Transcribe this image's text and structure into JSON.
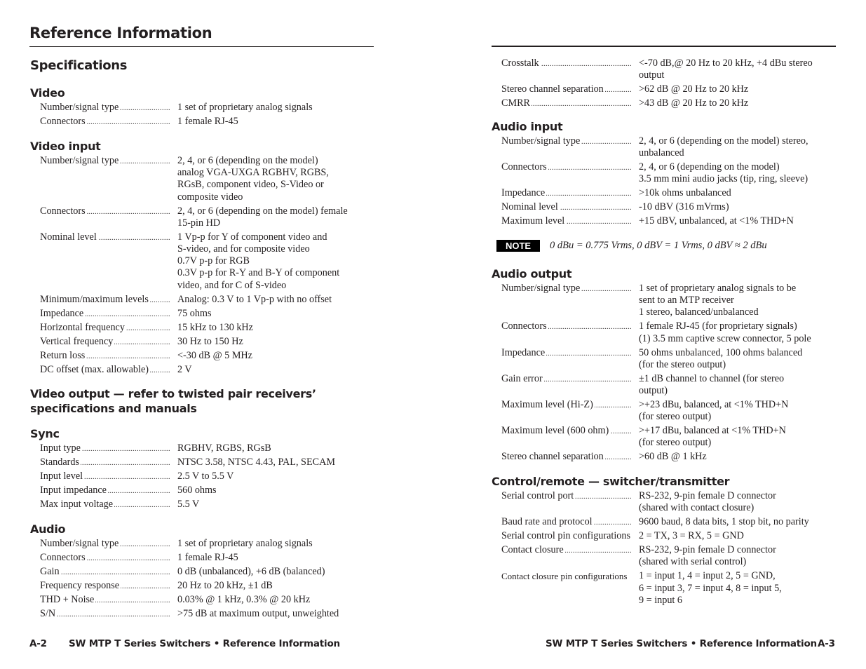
{
  "left_page": {
    "title": "Reference Information",
    "subtitle": "Specifications",
    "sections": {
      "video": {
        "heading": "Video",
        "rows": [
          {
            "label": "Number/signal type",
            "value": [
              "1 set of proprietary analog signals"
            ]
          },
          {
            "label": "Connectors",
            "value": [
              "1 female RJ-45"
            ]
          }
        ]
      },
      "video_input": {
        "heading": "Video input",
        "rows": [
          {
            "label": "Number/signal type",
            "value": [
              "2, 4, or 6 (depending on the model)",
              "analog VGA-UXGA RGBHV, RGBS,",
              "RGsB, component video, S-Video or",
              "composite video"
            ]
          },
          {
            "label": "Connectors",
            "value": [
              "2, 4, or 6 (depending on the model) female",
              "15-pin HD"
            ]
          },
          {
            "label": "Nominal level",
            "value": [
              "1 Vp-p for Y of component video and",
              "S-video, and for composite video",
              "0.7V p-p for RGB",
              "0.3V p-p for R-Y and B-Y of component",
              "video, and for C of S-video"
            ]
          },
          {
            "label": "Minimum/maximum levels",
            "value": [
              "Analog: 0.3 V to 1 Vp-p with no offset"
            ]
          },
          {
            "label": "Impedance",
            "value": [
              "75 ohms"
            ]
          },
          {
            "label": "Horizontal frequency",
            "value": [
              "15 kHz to 130 kHz"
            ]
          },
          {
            "label": "Vertical frequency",
            "value": [
              "30 Hz to 150 Hz"
            ]
          },
          {
            "label": "Return loss",
            "value": [
              "<-30 dB @ 5 MHz"
            ]
          },
          {
            "label": "DC offset (max. allowable)",
            "value": [
              "2 V"
            ]
          }
        ]
      },
      "video_output": {
        "heading_line1": "Video output — refer to twisted pair receivers’",
        "heading_line2": "specifications and manuals"
      },
      "sync": {
        "heading": "Sync",
        "rows": [
          {
            "label": "Input type",
            "value": [
              "RGBHV, RGBS, RGsB"
            ]
          },
          {
            "label": "Standards",
            "value": [
              "NTSC 3.58, NTSC 4.43, PAL, SECAM"
            ]
          },
          {
            "label": "Input level",
            "value": [
              "2.5 V to 5.5 V"
            ]
          },
          {
            "label": "Input impedance",
            "value": [
              "560 ohms"
            ]
          },
          {
            "label": "Max input voltage",
            "value": [
              "5.5 V"
            ]
          }
        ]
      },
      "audio": {
        "heading": "Audio",
        "rows": [
          {
            "label": "Number/signal type",
            "value": [
              "1 set of proprietary analog signals"
            ]
          },
          {
            "label": "Connectors",
            "value": [
              "1 female RJ-45"
            ]
          },
          {
            "label": "Gain",
            "value": [
              "0 dB (unbalanced), +6 dB (balanced)"
            ]
          },
          {
            "label": "Frequency response",
            "value": [
              "20 Hz to 20 kHz, ±1 dB"
            ]
          },
          {
            "label": "THD + Noise",
            "value": [
              "0.03% @ 1 kHz, 0.3% @ 20 kHz"
            ]
          },
          {
            "label": "S/N",
            "value": [
              ">75 dB at maximum output, unweighted"
            ]
          }
        ]
      }
    },
    "footer": {
      "page_number": "A-2",
      "text": "SW MTP T Series Switchers • Reference Information"
    }
  },
  "right_page": {
    "continued_audio": {
      "rows": [
        {
          "label": "Crosstalk",
          "value": [
            "<-70 dB,@ 20 Hz to 20 kHz, +4 dBu stereo",
            "output"
          ]
        },
        {
          "label": "Stereo channel separation",
          "value": [
            ">62 dB @ 20 Hz to 20 kHz"
          ]
        },
        {
          "label": "CMRR",
          "value": [
            ">43 dB @ 20 Hz to 20 kHz"
          ]
        }
      ]
    },
    "audio_input": {
      "heading": "Audio input",
      "rows": [
        {
          "label": "Number/signal type",
          "value": [
            "2, 4, or 6 (depending on the model) stereo,",
            "unbalanced"
          ]
        },
        {
          "label": "Connectors",
          "value": [
            "2, 4, or 6 (depending on the model)",
            "3.5 mm mini audio jacks (tip, ring, sleeve)"
          ]
        },
        {
          "label": "Impedance",
          "value": [
            ">10k ohms unbalanced"
          ]
        },
        {
          "label": "Nominal level",
          "value": [
            "-10 dBV (316 mVrms)"
          ]
        },
        {
          "label": "Maximum level",
          "value": [
            "+15 dBV, unbalanced, at <1% THD+N"
          ]
        }
      ]
    },
    "note": {
      "badge": "NOTE",
      "text": "0 dBu = 0.775 Vrms, 0 dBV = 1 Vrms, 0 dBV ≈ 2 dBu"
    },
    "audio_output": {
      "heading": "Audio output",
      "rows": [
        {
          "label": "Number/signal type",
          "value": [
            "1 set of proprietary analog signals to be",
            "sent to an MTP receiver",
            "1 stereo, balanced/unbalanced"
          ]
        },
        {
          "label": "Connectors",
          "value": [
            "1 female RJ-45 (for proprietary signals)",
            "(1) 3.5 mm captive screw connector, 5 pole"
          ]
        },
        {
          "label": "Impedance",
          "value": [
            "50 ohms unbalanced, 100 ohms balanced",
            "(for the stereo output)"
          ]
        },
        {
          "label": "Gain error",
          "value": [
            "±1 dB channel to channel (for stereo",
            "output)"
          ]
        },
        {
          "label": "Maximum level (Hi-Z)",
          "value": [
            ">+23 dBu, balanced, at <1% THD+N",
            "(for stereo output)"
          ]
        },
        {
          "label": "Maximum level (600 ohm)",
          "value": [
            ">+17 dBu, balanced at <1% THD+N",
            "(for stereo output)"
          ]
        },
        {
          "label": "Stereo channel separation",
          "value": [
            ">60 dB @ 1 kHz"
          ]
        }
      ]
    },
    "control": {
      "heading": "Control/remote — switcher/transmitter",
      "rows": [
        {
          "label": "Serial control port",
          "value": [
            "RS-232, 9-pin female D connector",
            "(shared with contact closure)"
          ]
        },
        {
          "label": "Baud rate and protocol",
          "value": [
            "9600 baud, 8 data bits, 1 stop bit, no parity"
          ]
        },
        {
          "label": "Serial control pin configurations",
          "value": [
            "2 = TX, 3 = RX, 5 = GND"
          ]
        },
        {
          "label": "Contact closure",
          "value": [
            "RS-232, 9-pin female D connector",
            "(shared with serial control)"
          ]
        },
        {
          "label": "Contact closure pin configurations",
          "value": [
            "1 = input 1, 4 = input 2, 5 = GND,",
            "6 = input 3, 7 = input 4, 8 = input 5,",
            "9 = input 6"
          ]
        }
      ]
    },
    "footer": {
      "text": "SW MTP T Series Switchers • Reference Information",
      "page_number": "A-3"
    }
  }
}
